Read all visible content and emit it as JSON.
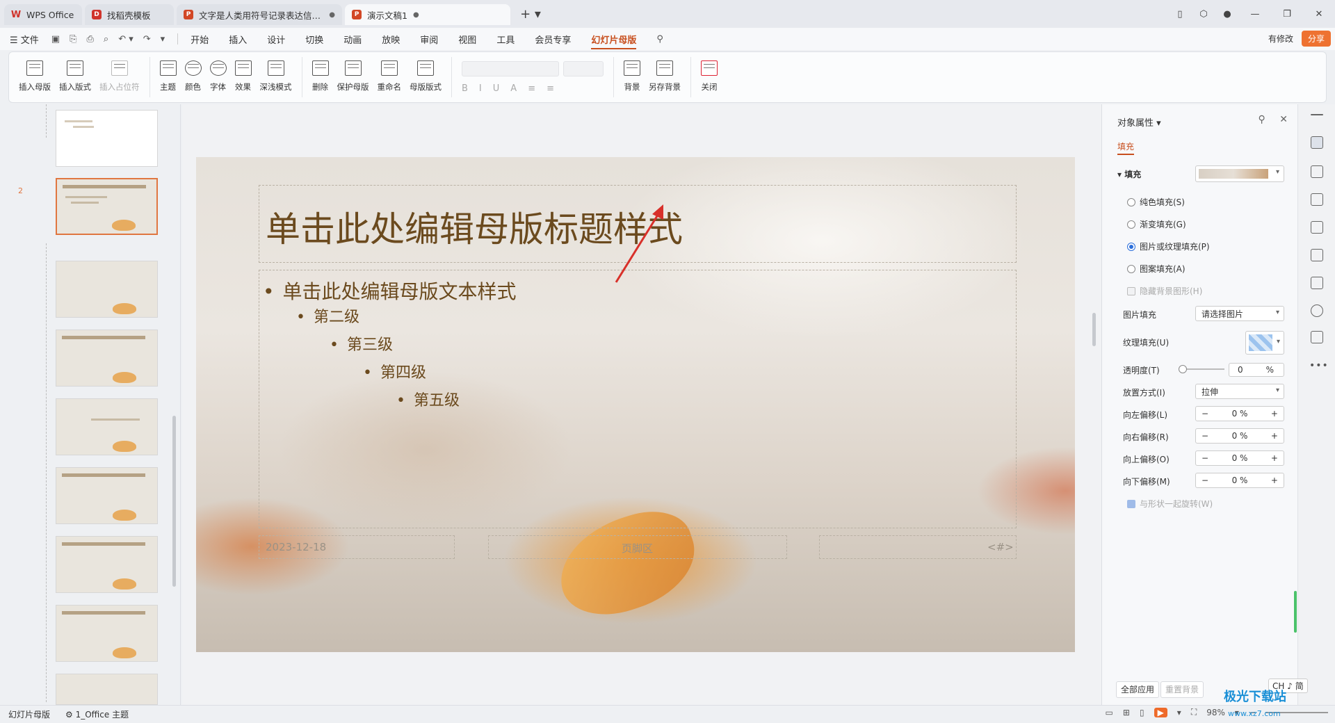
{
  "tabs": [
    {
      "title": "WPS Office"
    },
    {
      "title": "找稻壳模板"
    },
    {
      "title": "文字是人类用符号记录表达信息以",
      "dot": "●"
    },
    {
      "title": "演示文稿1",
      "dot": "●"
    }
  ],
  "menu": {
    "file": "☰ 文件",
    "items": [
      "开始",
      "插入",
      "设计",
      "切换",
      "动画",
      "放映",
      "审阅",
      "视图",
      "工具",
      "会员专享"
    ],
    "active": "幻灯片母版",
    "modified": "有修改",
    "share": "分享"
  },
  "ribbon": {
    "insert_master": "插入母版",
    "insert_layout": "插入版式",
    "insert_placeholder": "插入占位符",
    "theme": "主题",
    "color": "颜色",
    "font": "字体",
    "effect": "效果",
    "dark_light": "深浅模式",
    "delete": "删除",
    "protect_master": "保护母版",
    "rename": "重命名",
    "master_layout": "母版版式",
    "background": "背景",
    "save_background": "另存背景",
    "close": "关闭",
    "font_buttons": [
      "B",
      "I",
      "U",
      "A",
      "≡",
      "≡"
    ]
  },
  "slides": {
    "selected_number": "2"
  },
  "slide": {
    "title": "单击此处编辑母版标题样式",
    "level1": "单击此处编辑母版文本样式",
    "level2": "第二级",
    "level3": "第三级",
    "level4": "第四级",
    "level5": "第五级",
    "date": "2023-12-18",
    "footer": "页脚区",
    "number": "<#>"
  },
  "props": {
    "header": "对象属性",
    "tab_fill": "填充",
    "section_fill": "填充",
    "solid": "纯色填充(S)",
    "gradient": "渐变填充(G)",
    "picture": "图片或纹理填充(P)",
    "pattern": "图案填充(A)",
    "hide_bg": "隐藏背景图形(H)",
    "picture_fill_label": "图片填充",
    "picture_fill_value": "请选择图片",
    "texture_label": "纹理填充(U)",
    "transparency_label": "透明度(T)",
    "transparency_value": "0",
    "transparency_unit": "%",
    "placement_label": "放置方式(I)",
    "placement_value": "拉伸",
    "offset_left_label": "向左偏移(L)",
    "offset_right_label": "向右偏移(R)",
    "offset_up_label": "向上偏移(O)",
    "offset_down_label": "向下偏移(M)",
    "offset_value": "0 %",
    "rotate_with_shape": "与形状一起旋转(W)",
    "apply_all": "全部应用",
    "reset_bg": "重置背景"
  },
  "status": {
    "mode": "幻灯片母版",
    "theme": "1_Office 主题",
    "zoom": "98%"
  },
  "ime": "CH ♪ 简",
  "watermark": {
    "brand": "极光下载站",
    "url": "www.xz7.com"
  }
}
